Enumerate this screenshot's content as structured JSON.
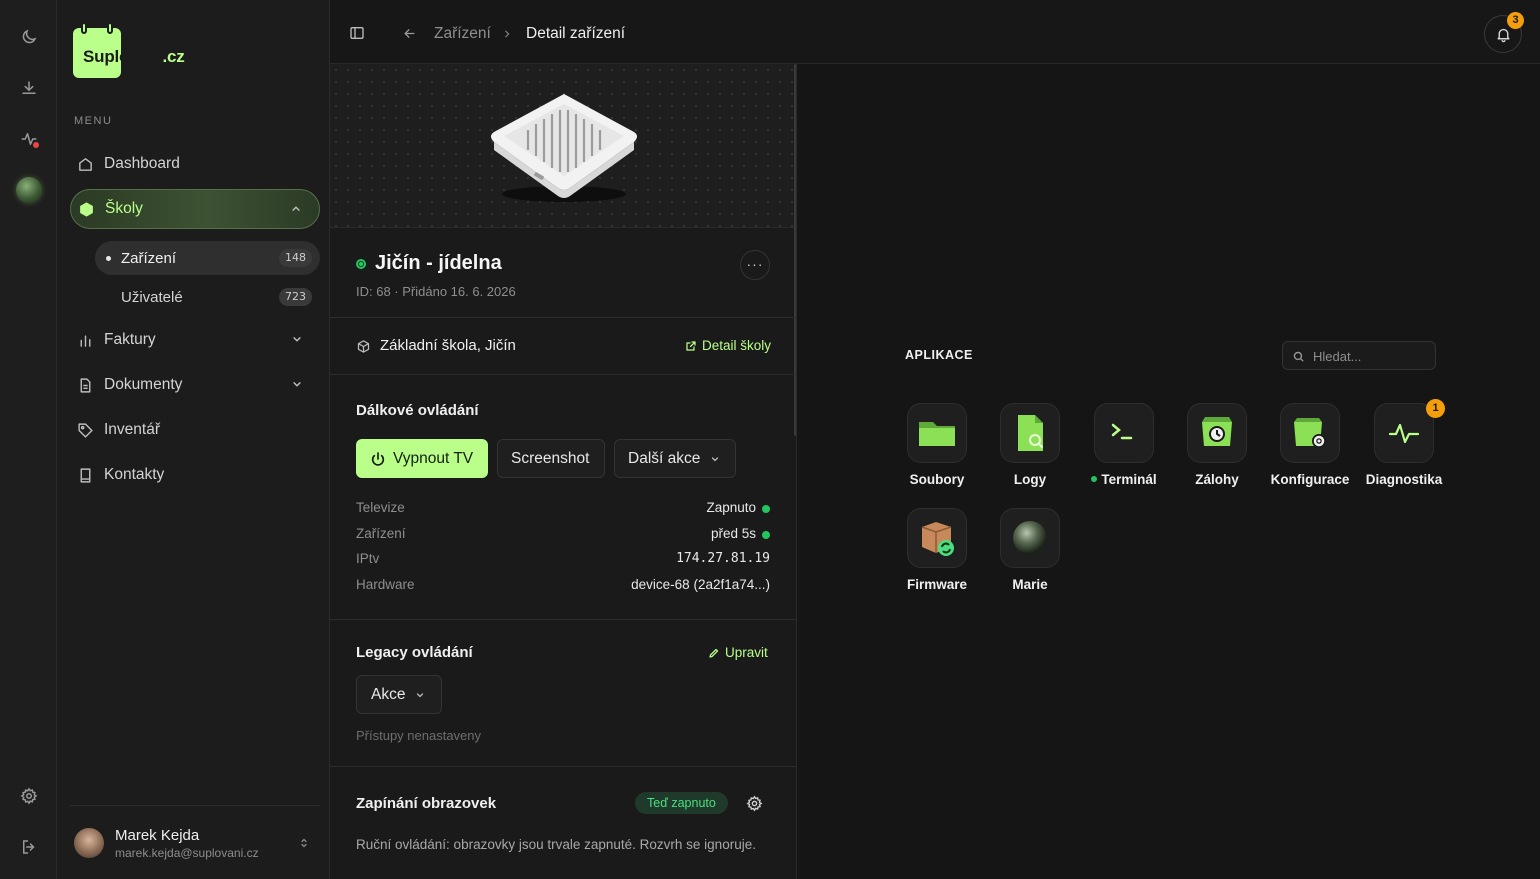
{
  "app": {
    "brand_name": "Suplování",
    "brand_tld": ".cz",
    "accent_color": "#b9ff8a",
    "status_color": "#22c55e"
  },
  "rail": {
    "icons": [
      "moon-icon",
      "download-icon",
      "activity-icon",
      "orb-avatar",
      "gear-icon",
      "logout-icon"
    ]
  },
  "sidebar": {
    "menu_label": "MENU",
    "items": [
      {
        "label": "Dashboard",
        "icon": "home-icon"
      },
      {
        "label": "Školy",
        "icon": "cube-icon",
        "expanded": true
      },
      {
        "label": "Faktury",
        "icon": "bar-chart-icon"
      },
      {
        "label": "Dokumenty",
        "icon": "document-icon"
      },
      {
        "label": "Inventář",
        "icon": "tag-icon"
      },
      {
        "label": "Kontakty",
        "icon": "contacts-book-icon"
      }
    ],
    "sub_items": [
      {
        "label": "Zařízení",
        "count": "148",
        "active": true
      },
      {
        "label": "Uživatelé",
        "count": "723"
      }
    ],
    "user": {
      "name": "Marek Kejda",
      "email": "marek.kejda@suplovani.cz"
    }
  },
  "topbar": {
    "breadcrumb_parent": "Zařízení",
    "breadcrumb_current": "Detail zařízení",
    "notification_count": "3"
  },
  "device": {
    "name": "Jičín - jídelna",
    "meta": "ID: 68 · Přidáno 16. 6. 2026",
    "more_label": "···",
    "school_name": "Základní škola, Jičín",
    "school_link": "Detail školy",
    "remote": {
      "title": "Dálkové ovládání",
      "power_button": "Vypnout TV",
      "screenshot_button": "Screenshot",
      "more_actions_button": "Další akce",
      "rows": [
        {
          "key": "Televize",
          "value": "Zapnuto"
        },
        {
          "key": "Zařízení",
          "value": "před 5s"
        },
        {
          "key": "IPtv",
          "value": "174.27.81.19"
        },
        {
          "key": "Hardware",
          "value": "device-68 (2a2f1a74...)"
        }
      ]
    },
    "legacy": {
      "title": "Legacy ovládání",
      "edit_link": "Upravit",
      "actions_button": "Akce",
      "note": "Přístupy nenastaveny"
    },
    "screens": {
      "title": "Zapínání obrazovek",
      "status_pill": "Teď zapnuto",
      "description": "Ruční ovládání: obrazovky jsou trvale zapnuté. Rozvrh se ignoruje."
    }
  },
  "apps": {
    "title": "APLIKACE",
    "search_placeholder": "Hledat...",
    "items": [
      {
        "label": "Soubory",
        "icon": "folder-icon"
      },
      {
        "label": "Logy",
        "icon": "log-file-icon"
      },
      {
        "label": "Terminál",
        "icon": "terminal-icon",
        "online": true
      },
      {
        "label": "Zálohy",
        "icon": "backup-clock-icon"
      },
      {
        "label": "Konfigurace",
        "icon": "config-gear-icon"
      },
      {
        "label": "Diagnostika",
        "icon": "pulse-icon",
        "badge": "1"
      },
      {
        "label": "Firmware",
        "icon": "firmware-package-icon"
      },
      {
        "label": "Marie",
        "icon": "marie-orb-icon"
      }
    ]
  }
}
